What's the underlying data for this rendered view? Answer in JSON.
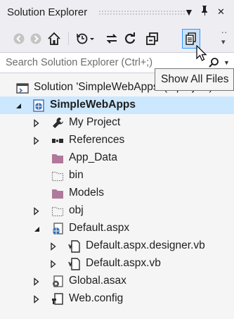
{
  "title": "Solution Explorer",
  "title_buttons": {
    "dropdown": "▾",
    "pin": "ᵖ",
    "close": "✕"
  },
  "search": {
    "placeholder": "Search Solution Explorer (Ctrl+;)"
  },
  "tooltip": "Show All Files",
  "tree": [
    {
      "label": "Solution 'SimpleWebApps' (1 project)",
      "icon": "solution-icon",
      "expander": "none",
      "level": 0,
      "bold": false,
      "selected": false
    },
    {
      "label": "SimpleWebApps",
      "icon": "web-project-icon",
      "expander": "expanded",
      "level": 1,
      "bold": true,
      "selected": true
    },
    {
      "label": "My Project",
      "icon": "wrench-icon",
      "expander": "collapsed",
      "level": 2,
      "bold": false,
      "selected": false
    },
    {
      "label": "References",
      "icon": "references-icon",
      "expander": "collapsed",
      "level": 2,
      "bold": false,
      "selected": false
    },
    {
      "label": "App_Data",
      "icon": "folder-icon",
      "expander": "none",
      "level": 2,
      "bold": false,
      "selected": false
    },
    {
      "label": "bin",
      "icon": "dotted-folder-icon",
      "expander": "none",
      "level": 2,
      "bold": false,
      "selected": false
    },
    {
      "label": "Models",
      "icon": "folder-icon",
      "expander": "none",
      "level": 2,
      "bold": false,
      "selected": false
    },
    {
      "label": "obj",
      "icon": "dotted-folder-icon",
      "expander": "collapsed",
      "level": 2,
      "bold": false,
      "selected": false
    },
    {
      "label": "Default.aspx",
      "icon": "web-form-icon",
      "expander": "expanded",
      "level": 2,
      "bold": false,
      "selected": false
    },
    {
      "label": "Default.aspx.designer.vb",
      "icon": "vb-file-icon",
      "expander": "collapsed",
      "level": 3,
      "bold": false,
      "selected": false
    },
    {
      "label": "Default.aspx.vb",
      "icon": "vb-file-icon",
      "expander": "collapsed",
      "level": 3,
      "bold": false,
      "selected": false
    },
    {
      "label": "Global.asax",
      "icon": "global-asax-icon",
      "expander": "collapsed",
      "level": 2,
      "bold": false,
      "selected": false
    },
    {
      "label": "Web.config",
      "icon": "config-icon",
      "expander": "collapsed",
      "level": 2,
      "bold": false,
      "selected": false
    }
  ],
  "colors": {
    "accent": "#3399ff",
    "selected_row": "#cce8ff",
    "folder": "#b0789a",
    "project": "#3a6fb5",
    "expander": "#1e1e1e"
  }
}
